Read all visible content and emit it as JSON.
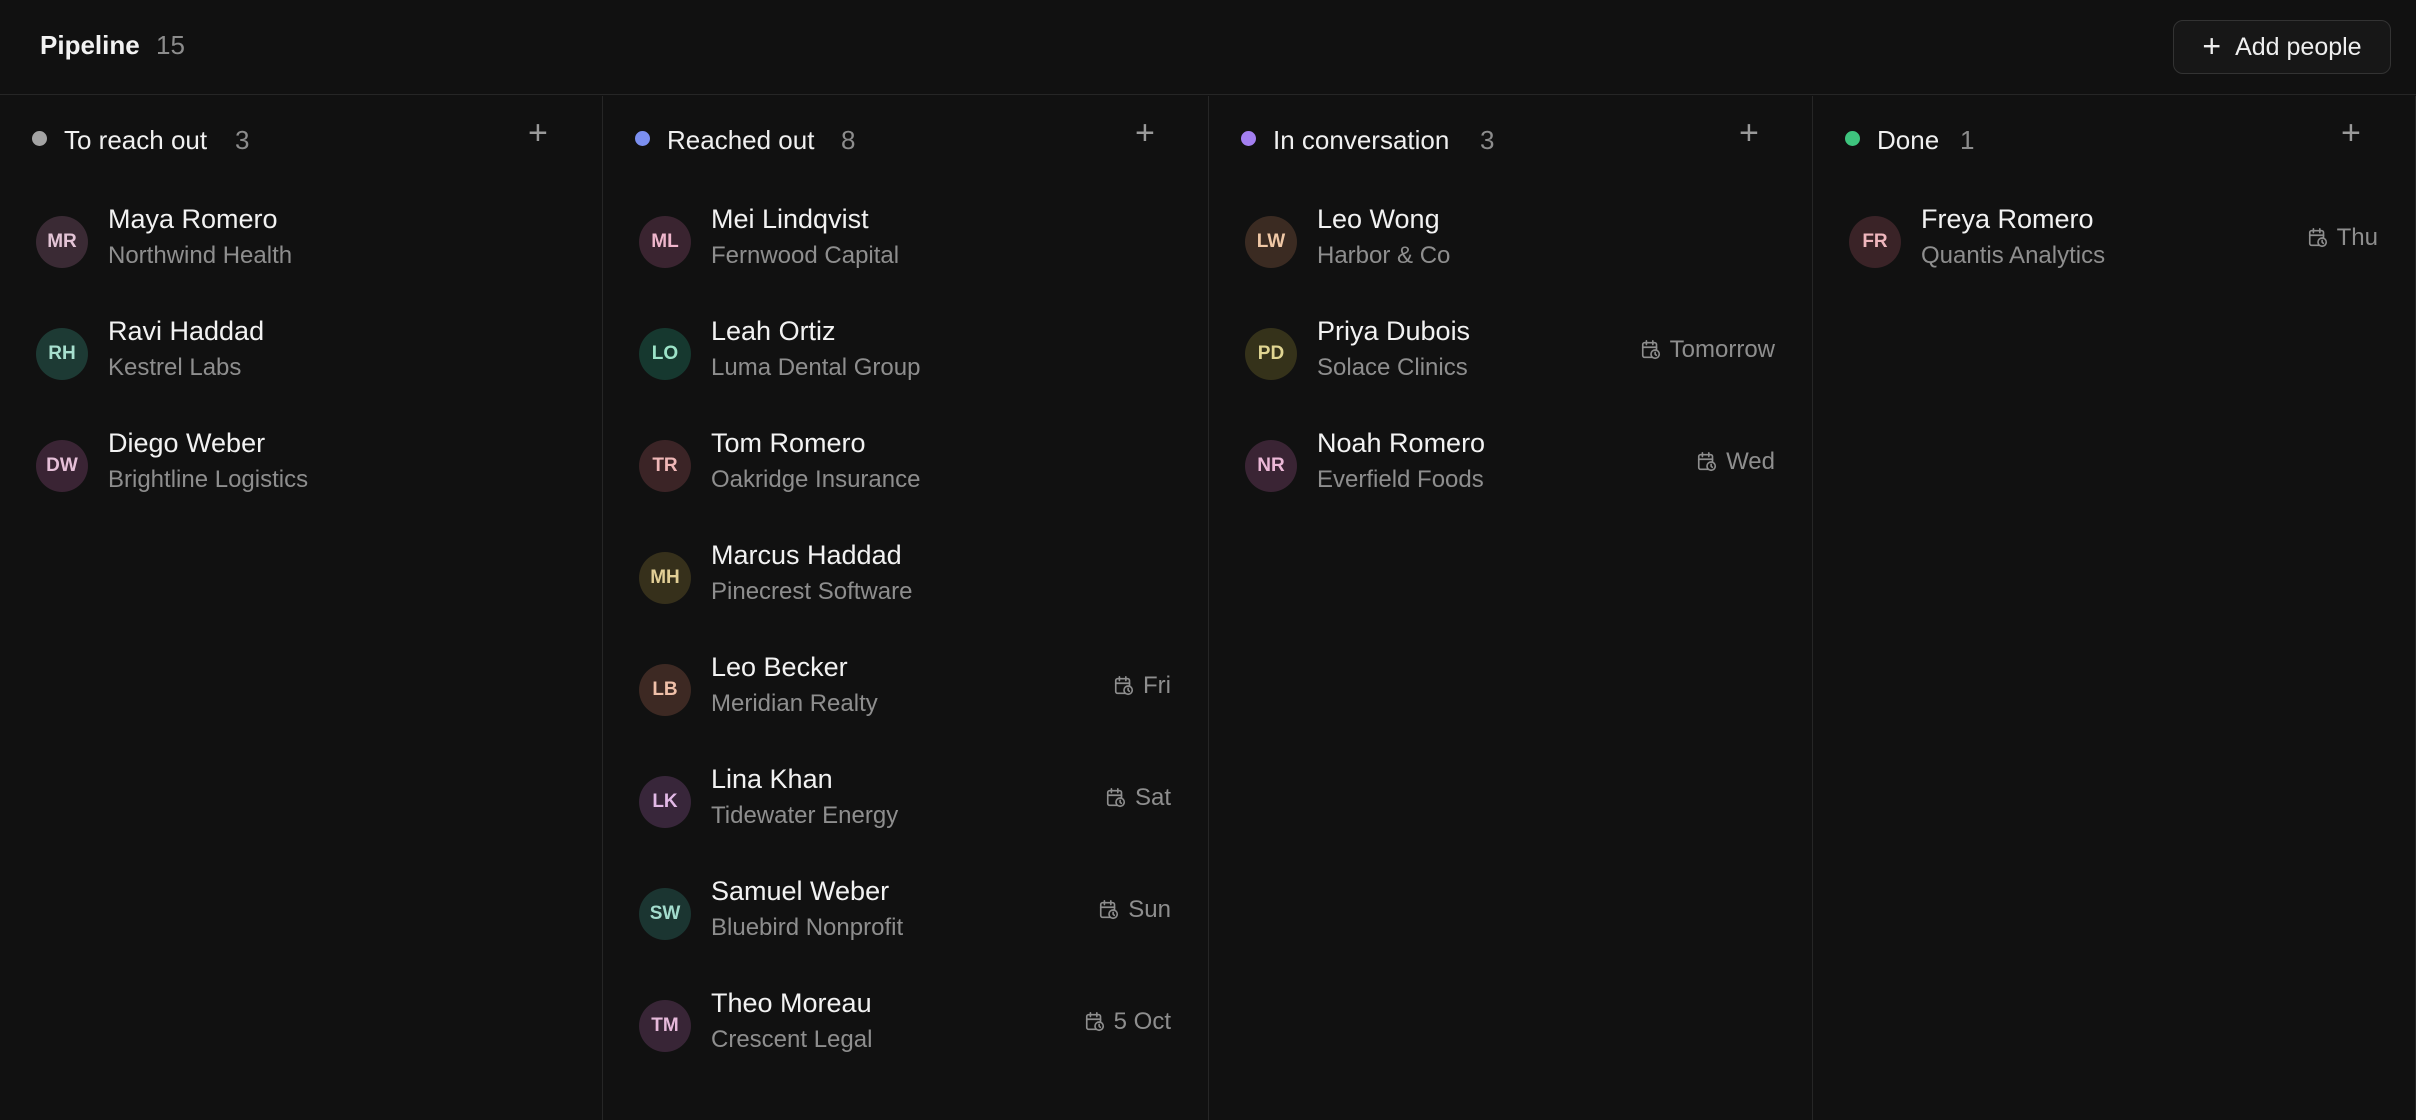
{
  "header": {
    "title": "Pipeline",
    "count": "15",
    "add_button_label": "Add people",
    "add_button_icon": "plus-icon"
  },
  "columns": [
    {
      "title": "To reach out",
      "count": "3",
      "dot_color": "#a3a3a3",
      "add_icon": "plus-icon",
      "cards": [
        {
          "initials": "MR",
          "name": "Maya Romero",
          "company": "Northwind Health",
          "due": ""
        },
        {
          "initials": "RH",
          "name": "Ravi Haddad",
          "company": "Kestrel Labs",
          "due": ""
        },
        {
          "initials": "DW",
          "name": "Diego Weber",
          "company": "Brightline Logistics",
          "due": ""
        }
      ]
    },
    {
      "title": "Reached out",
      "count": "8",
      "dot_color": "#7b8ff0",
      "add_icon": "plus-icon",
      "cards": [
        {
          "initials": "ML",
          "name": "Mei Lindqvist",
          "company": "Fernwood Capital",
          "due": ""
        },
        {
          "initials": "LO",
          "name": "Leah Ortiz",
          "company": "Luma Dental Group",
          "due": ""
        },
        {
          "initials": "TR",
          "name": "Tom Romero",
          "company": "Oakridge Insurance",
          "due": ""
        },
        {
          "initials": "MH",
          "name": "Marcus Haddad",
          "company": "Pinecrest Software",
          "due": ""
        },
        {
          "initials": "LB",
          "name": "Leo Becker",
          "company": "Meridian Realty",
          "due": "Fri"
        },
        {
          "initials": "LK",
          "name": "Lina Khan",
          "company": "Tidewater Energy",
          "due": "Sat"
        },
        {
          "initials": "SW",
          "name": "Samuel Weber",
          "company": "Bluebird Nonprofit",
          "due": "Sun"
        },
        {
          "initials": "TM",
          "name": "Theo Moreau",
          "company": "Crescent Legal",
          "due": "5 Oct"
        }
      ]
    },
    {
      "title": "In conversation",
      "count": "3",
      "dot_color": "#a37ff0",
      "add_icon": "plus-icon",
      "cards": [
        {
          "initials": "LW",
          "name": "Leo Wong",
          "company": "Harbor & Co",
          "due": ""
        },
        {
          "initials": "PD",
          "name": "Priya Dubois",
          "company": "Solace Clinics",
          "due": "Tomorrow"
        },
        {
          "initials": "NR",
          "name": "Noah Romero",
          "company": "Everfield Foods",
          "due": "Wed"
        }
      ]
    },
    {
      "title": "Done",
      "count": "1",
      "dot_color": "#3ec47e",
      "add_icon": "plus-icon",
      "cards": [
        {
          "initials": "FR",
          "name": "Freya Romero",
          "company": "Quantis Analytics",
          "due": "Thu"
        }
      ]
    }
  ],
  "avatar_palette": {
    "MR": {
      "bg": "#3a2a34",
      "fg": "#e3c4d6"
    },
    "RH": {
      "bg": "#1d3a34",
      "fg": "#a7e0cf"
    },
    "DW": {
      "bg": "#3a2434",
      "fg": "#e6bfd8"
    },
    "ML": {
      "bg": "#3a2430",
      "fg": "#efb6cc"
    },
    "LO": {
      "bg": "#16382f",
      "fg": "#9ce3c8"
    },
    "TR": {
      "bg": "#3b2426",
      "fg": "#efb7b7"
    },
    "MH": {
      "bg": "#36301b",
      "fg": "#e2cf96"
    },
    "LB": {
      "bg": "#3d2923",
      "fg": "#f0c0a9"
    },
    "LK": {
      "bg": "#38263a",
      "fg": "#e2b9e6"
    },
    "SW": {
      "bg": "#1b3531",
      "fg": "#a3dccd"
    },
    "TM": {
      "bg": "#382536",
      "fg": "#e6b9da"
    },
    "LW": {
      "bg": "#3b2b22",
      "fg": "#f0c8a6"
    },
    "PD": {
      "bg": "#35321a",
      "fg": "#e0d592"
    },
    "NR": {
      "bg": "#3a2434",
      "fg": "#ebb8d7"
    },
    "FR": {
      "bg": "#3a2327",
      "fg": "#efb6bd"
    }
  },
  "due_icon": "calendar-clock-icon"
}
